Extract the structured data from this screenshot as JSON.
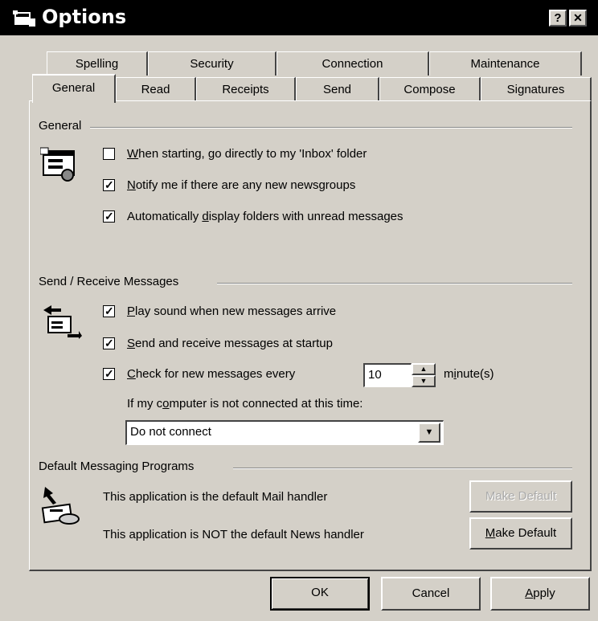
{
  "window": {
    "title": "Options",
    "help_label": "?",
    "close_label": "✕"
  },
  "tabs": {
    "row_back": [
      {
        "label": "Spelling"
      },
      {
        "label": "Security"
      },
      {
        "label": "Connection"
      },
      {
        "label": "Maintenance"
      }
    ],
    "row_front": [
      {
        "label": "General",
        "active": true
      },
      {
        "label": "Read"
      },
      {
        "label": "Receipts"
      },
      {
        "label": "Send"
      },
      {
        "label": "Compose"
      },
      {
        "label": "Signatures"
      }
    ]
  },
  "general": {
    "heading": "General",
    "icon": "settings-window-icon",
    "options": [
      {
        "pre": "",
        "key": "W",
        "post": "hen starting, go directly to my 'Inbox' folder",
        "checked": false
      },
      {
        "pre": "",
        "key": "N",
        "post": "otify me if there are any new newsgroups",
        "checked": true
      },
      {
        "pre": "Automatically ",
        "key": "d",
        "post": "isplay folders with unread messages",
        "checked": true
      }
    ]
  },
  "send_receive": {
    "heading": "Send / Receive Messages",
    "icon": "send-receive-icon",
    "options": [
      {
        "pre": "",
        "key": "P",
        "post": "lay sound when new messages arrive",
        "checked": true
      },
      {
        "pre": "",
        "key": "S",
        "post": "end and receive messages at startup",
        "checked": true
      },
      {
        "pre": "",
        "key": "C",
        "post": "heck for new messages every",
        "checked": true
      }
    ],
    "interval_value": "10",
    "interval_unit_pre": "m",
    "interval_unit_key": "i",
    "interval_unit_post": "nute(s)",
    "not_connected_pre": "If my c",
    "not_connected_key": "o",
    "not_connected_post": "mputer is not connected at this time:",
    "connect_option": "Do not connect"
  },
  "default_programs": {
    "heading": "Default Messaging Programs",
    "icon": "default-programs-icon",
    "mail_text": "This application is the default Mail handler",
    "news_text": "This application is NOT the default News handler",
    "make_default_mail_label": "Make Default",
    "make_default_news_pre": "",
    "make_default_news_key": "M",
    "make_default_news_post": "ake Default"
  },
  "footer": {
    "ok_label": "OK",
    "cancel_label": "Cancel",
    "apply_pre": "",
    "apply_key": "A",
    "apply_post": "pply"
  }
}
